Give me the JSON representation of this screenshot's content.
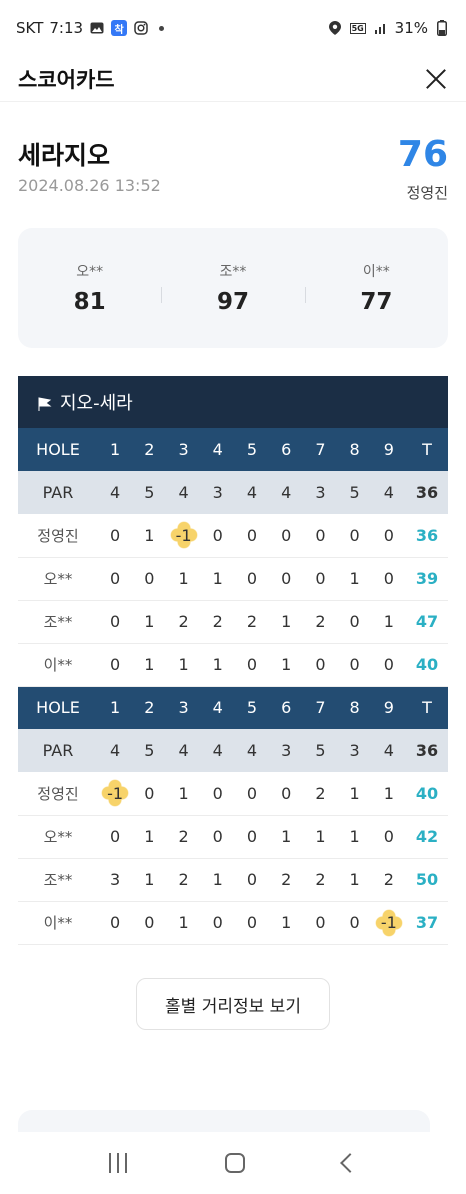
{
  "status_bar": {
    "carrier": "SKT",
    "time": "7:13",
    "app_badge": "착",
    "network": "5G",
    "battery": "31%"
  },
  "header": {
    "title": "스코어카드"
  },
  "course": {
    "name": "세라지오",
    "datetime": "2024.08.26 13:52",
    "my_score": "76",
    "my_name": "정영진"
  },
  "companions": [
    {
      "name": "오**",
      "score": "81"
    },
    {
      "name": "조**",
      "score": "97"
    },
    {
      "name": "이**",
      "score": "77"
    }
  ],
  "scorecard": {
    "course_label": "지오-세라",
    "hole_header": [
      "HOLE",
      "1",
      "2",
      "3",
      "4",
      "5",
      "6",
      "7",
      "8",
      "9",
      "T"
    ],
    "front": {
      "par": [
        "PAR",
        "4",
        "5",
        "4",
        "3",
        "4",
        "4",
        "3",
        "5",
        "4",
        "36"
      ],
      "players": [
        {
          "cells": [
            "정영진",
            "0",
            "1",
            "-1",
            "0",
            "0",
            "0",
            "0",
            "0",
            "0",
            "36"
          ],
          "birdies": [
            3
          ]
        },
        {
          "cells": [
            "오**",
            "0",
            "0",
            "1",
            "1",
            "0",
            "0",
            "0",
            "1",
            "0",
            "39"
          ],
          "birdies": []
        },
        {
          "cells": [
            "조**",
            "0",
            "1",
            "2",
            "2",
            "2",
            "1",
            "2",
            "0",
            "1",
            "47"
          ],
          "birdies": []
        },
        {
          "cells": [
            "이**",
            "0",
            "1",
            "1",
            "1",
            "0",
            "1",
            "0",
            "0",
            "0",
            "40"
          ],
          "birdies": []
        }
      ]
    },
    "back": {
      "par": [
        "PAR",
        "4",
        "5",
        "4",
        "4",
        "4",
        "3",
        "5",
        "3",
        "4",
        "36"
      ],
      "players": [
        {
          "cells": [
            "정영진",
            "-1",
            "0",
            "1",
            "0",
            "0",
            "0",
            "2",
            "1",
            "1",
            "40"
          ],
          "birdies": [
            1
          ]
        },
        {
          "cells": [
            "오**",
            "0",
            "1",
            "2",
            "0",
            "0",
            "1",
            "1",
            "1",
            "0",
            "42"
          ],
          "birdies": []
        },
        {
          "cells": [
            "조**",
            "3",
            "1",
            "2",
            "1",
            "0",
            "2",
            "2",
            "1",
            "2",
            "50"
          ],
          "birdies": []
        },
        {
          "cells": [
            "이**",
            "0",
            "0",
            "1",
            "0",
            "0",
            "1",
            "0",
            "0",
            "-1",
            "37"
          ],
          "birdies": [
            9
          ]
        }
      ]
    }
  },
  "distance_button": {
    "label": "홀별 거리정보 보기"
  }
}
